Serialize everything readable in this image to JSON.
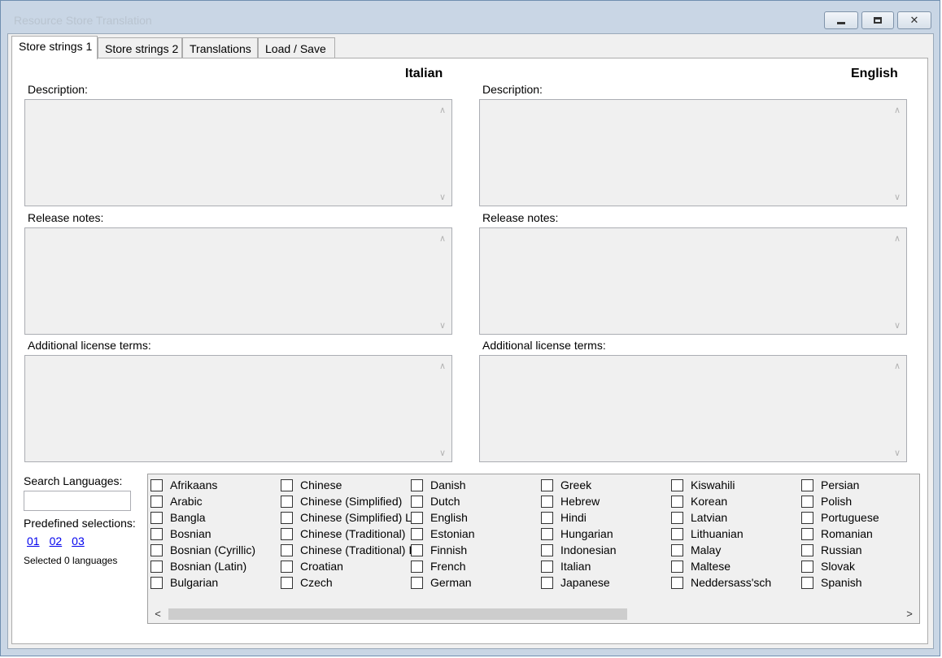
{
  "window": {
    "title": "Resource Store Translation",
    "controls": {
      "minimize": "minimize-icon",
      "maximize": "restore-icon",
      "close": "✕"
    }
  },
  "tabs": [
    "Store strings 1",
    "Store strings 2",
    "Translations",
    "Load / Save"
  ],
  "left": {
    "language": "Italian",
    "description_label": "Description:",
    "release_label": "Release notes:",
    "license_label": "Additional license terms:"
  },
  "right": {
    "language": "English",
    "description_label": "Description:",
    "release_label": "Release notes:",
    "license_label": "Additional license terms:"
  },
  "search": {
    "label": "Search Languages:",
    "value": ""
  },
  "predefined": {
    "label": "Predefined selections:",
    "links": [
      "01",
      "02",
      "03"
    ]
  },
  "selected_text": "Selected 0 languages",
  "language_columns": [
    [
      "Afrikaans",
      "Arabic",
      "Bangla",
      "Bosnian",
      "Bosnian (Cyrillic)",
      "Bosnian (Latin)",
      "Bulgarian"
    ],
    [
      "Chinese",
      "Chinese (Simplified)",
      "Chinese (Simplified) L",
      "Chinese (Traditional)",
      "Chinese (Traditional) I",
      "Croatian",
      "Czech"
    ],
    [
      "Danish",
      "Dutch",
      "English",
      "Estonian",
      "Finnish",
      "French",
      "German"
    ],
    [
      "Greek",
      "Hebrew",
      "Hindi",
      "Hungarian",
      "Indonesian",
      "Italian",
      "Japanese"
    ],
    [
      "Kiswahili",
      "Korean",
      "Latvian",
      "Lithuanian",
      "Malay",
      "Maltese",
      "Neddersass'sch"
    ],
    [
      "Persian",
      "Polish",
      "Portuguese",
      "Romanian",
      "Russian",
      "Slovak",
      "Spanish"
    ]
  ],
  "scrollbar": {
    "left_arrow": "<",
    "right_arrow": ">"
  },
  "colors": {
    "chrome": "#c9d6e5",
    "panel": "#f0f0f0",
    "link": "#0000ee"
  }
}
